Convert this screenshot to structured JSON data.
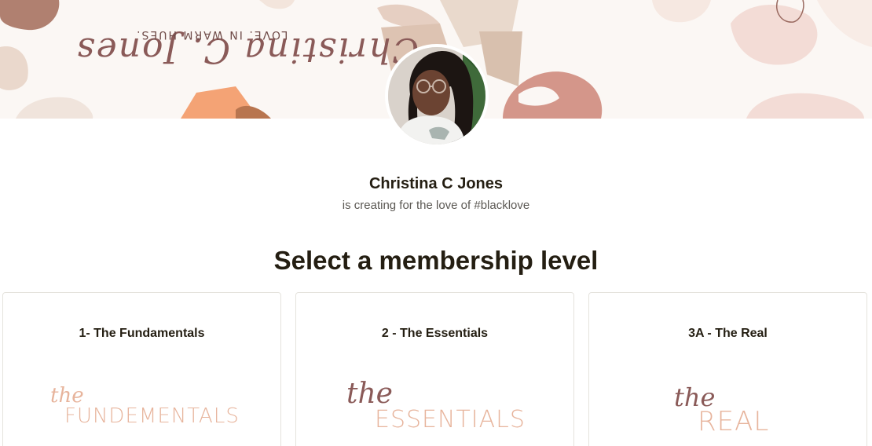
{
  "banner": {
    "script_text": "Christina C. Jones",
    "tagline": "LOVE. IN WARM HUES."
  },
  "creator": {
    "name": "Christina C Jones",
    "tagline": "is creating for the love of #blacklove"
  },
  "section_title": "Select a membership level",
  "tiers": [
    {
      "name": "1- The Fundamentals",
      "logo_script": "the",
      "logo_word": "FUNDEMENTALS"
    },
    {
      "name": "2 - The Essentials",
      "logo_script": "the",
      "logo_word": "ESSENTIALS"
    },
    {
      "name": "3A - The Real",
      "logo_script": "the",
      "logo_word": "REAL"
    }
  ],
  "colors": {
    "text_primary": "#241e12",
    "text_secondary": "#5b5853",
    "logo_script": "#8a5a58",
    "logo_word": "#e7b49c",
    "card_border": "#e5e3dd"
  }
}
